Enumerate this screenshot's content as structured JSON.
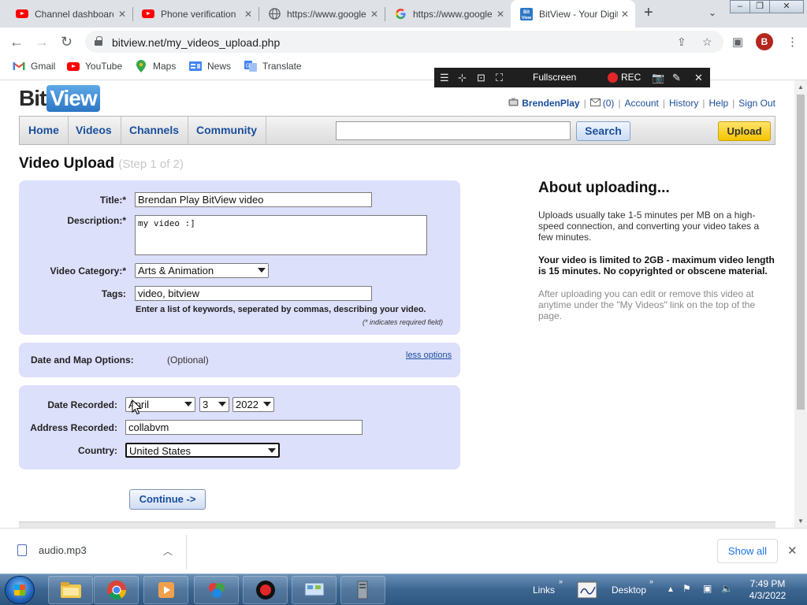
{
  "browser": {
    "tabs": [
      {
        "title": "Channel dashboard",
        "icon": "youtube-icon"
      },
      {
        "title": "Phone verification",
        "icon": "youtube-icon"
      },
      {
        "title": "https://www.google",
        "icon": "globe-icon"
      },
      {
        "title": "https://www.google",
        "icon": "google-icon"
      },
      {
        "title": "BitView - Your Digital",
        "icon": "bitview-icon"
      }
    ],
    "url": "bitview.net/my_videos_upload.php",
    "profile_initial": "B",
    "bookmarks": [
      "Gmail",
      "YouTube",
      "Maps",
      "News",
      "Translate"
    ]
  },
  "recorder": {
    "fullscreen_label": "Fullscreen",
    "rec_label": "REC"
  },
  "site": {
    "logo_bit": "Bit",
    "logo_view": "View",
    "user": {
      "name": "BrendenPlay",
      "inbox_count": "(0)",
      "links": [
        "Account",
        "History",
        "Help",
        "Sign Out"
      ]
    },
    "nav": [
      "Home",
      "Videos",
      "Channels",
      "Community"
    ],
    "search_label": "Search",
    "search_value": "",
    "upload_label": "Upload"
  },
  "page": {
    "title": "Video Upload",
    "step": "(Step 1 of 2)"
  },
  "form": {
    "title_label": "Title:*",
    "title_value": "Brendan Play BitView video",
    "description_label": "Description:*",
    "description_value": "my video :]",
    "category_label": "Video Category:*",
    "category_value": "Arts & Animation",
    "tags_label": "Tags:",
    "tags_value": "video, bitview",
    "tags_hint": "Enter a list of keywords, seperated by commas, describing your video.",
    "required_note": "(* indicates required field)"
  },
  "options": {
    "label": "Date and Map Options:",
    "optional": "(Optional)",
    "toggle": "less options"
  },
  "date_map": {
    "date_label": "Date Recorded:",
    "month": "April",
    "day": "3",
    "year": "2022",
    "address_label": "Address Recorded:",
    "address_value": "collabvm",
    "country_label": "Country:",
    "country_value": "United States"
  },
  "continue_label": "Continue ->",
  "about": {
    "heading": "About uploading...",
    "p1": "Uploads usually take 1-5 minutes per MB on a high-speed connection, and converting your video takes a few minutes.",
    "p2": "Your video is limited to 2GB - maximum video length is 15 minutes. No copyrighted or obscene material.",
    "p3": "After uploading you can edit or remove this video at anytime under the \"My Videos\" link on the top of the page."
  },
  "downloads": {
    "file": "audio.mp3",
    "show_all": "Show all"
  },
  "taskbar": {
    "links_label": "Links",
    "desktop_label": "Desktop",
    "time": "7:49 PM",
    "date": "4/3/2022"
  }
}
